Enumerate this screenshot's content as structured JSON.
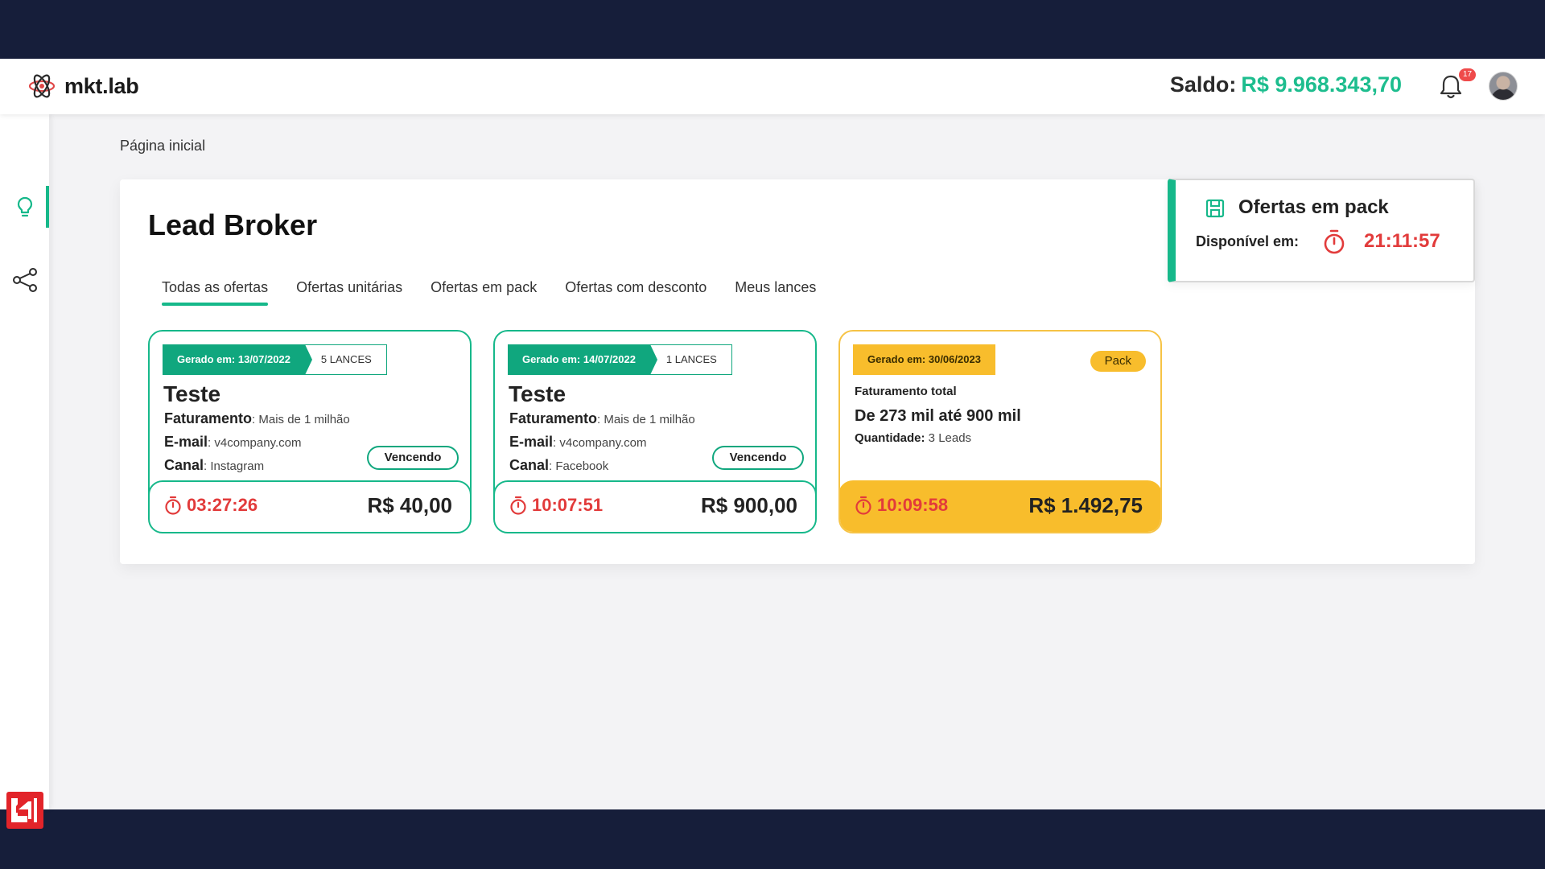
{
  "header": {
    "brand": "mkt.lab",
    "balance_label": "Saldo:",
    "balance_value": "R$ 9.968.343,70",
    "notification_count": "17"
  },
  "sidebar": {
    "items": [
      {
        "icon": "lightbulb-icon",
        "active": true
      },
      {
        "icon": "share-icon",
        "active": false
      }
    ]
  },
  "breadcrumb": "Página inicial",
  "page_title": "Lead Broker",
  "tabs": [
    "Todas as ofertas",
    "Ofertas unitárias",
    "Ofertas em pack",
    "Ofertas com desconto",
    "Meus lances"
  ],
  "offers": [
    {
      "generated": "Gerado em: 13/07/2022",
      "bids": "5 LANCES",
      "name": "Teste",
      "faturamento_label": "Faturamento",
      "faturamento_value": ": Mais de 1 milhão",
      "email_label": "E-mail",
      "email_value": ": v4company.com",
      "canal_label": "Canal",
      "canal_value": ": Instagram",
      "status": "Vencendo",
      "timer": "03:27:26",
      "price": "R$ 40,00"
    },
    {
      "generated": "Gerado em: 14/07/2022",
      "bids": "1 LANCES",
      "name": "Teste",
      "faturamento_label": "Faturamento",
      "faturamento_value": ": Mais de 1 milhão",
      "email_label": "E-mail",
      "email_value": ": v4company.com",
      "canal_label": "Canal",
      "canal_value": ": Facebook",
      "status": "Vencendo",
      "timer": "10:07:51",
      "price": "R$ 900,00"
    }
  ],
  "pack_offer": {
    "generated": "Gerado em: 30/06/2023",
    "tag": "Pack",
    "faturamento_label": "Faturamento total",
    "range": "De 273 mil até 900 mil",
    "qty_label": "Quantidade:",
    "qty_value": " 3 Leads",
    "timer": "10:09:58",
    "price": "R$ 1.492,75"
  },
  "pack_panel": {
    "title": "Ofertas em pack",
    "available_label": "Disponível em:",
    "timer": "21:11:57"
  },
  "colors": {
    "accent": "#16b88a",
    "timer": "#e23b3b",
    "pack": "#f8bd2c",
    "frame": "#161e3a"
  }
}
